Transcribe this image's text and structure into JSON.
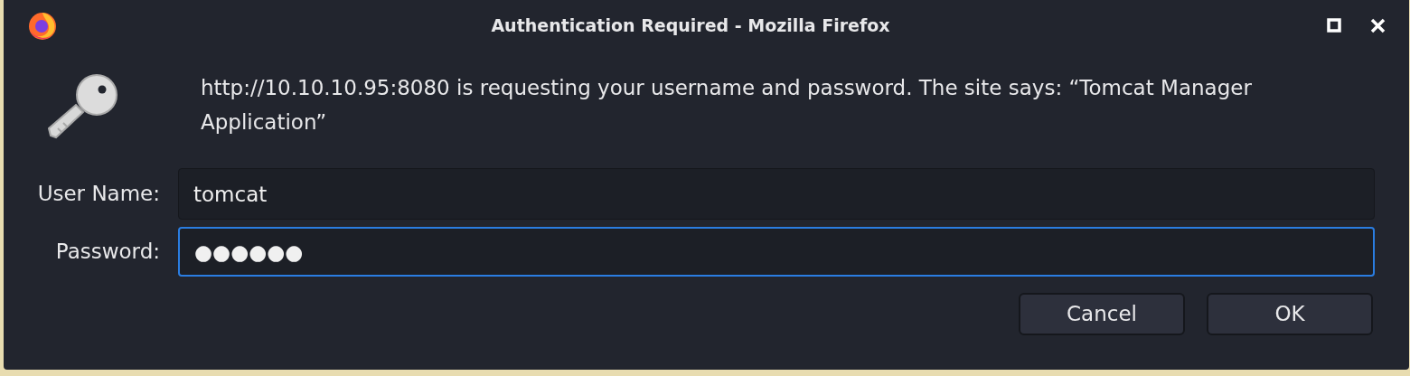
{
  "window": {
    "title": "Authentication Required - Mozilla Firefox"
  },
  "message": "http://10.10.10.95:8080 is requesting your username and password. The site says: “Tomcat Manager Application”",
  "fields": [
    {
      "label": "User Name:",
      "value": "tomcat",
      "focused": false
    },
    {
      "label": "Password:",
      "value": "●●●●●●",
      "focused": true
    }
  ],
  "buttons": [
    "Cancel",
    "OK"
  ]
}
